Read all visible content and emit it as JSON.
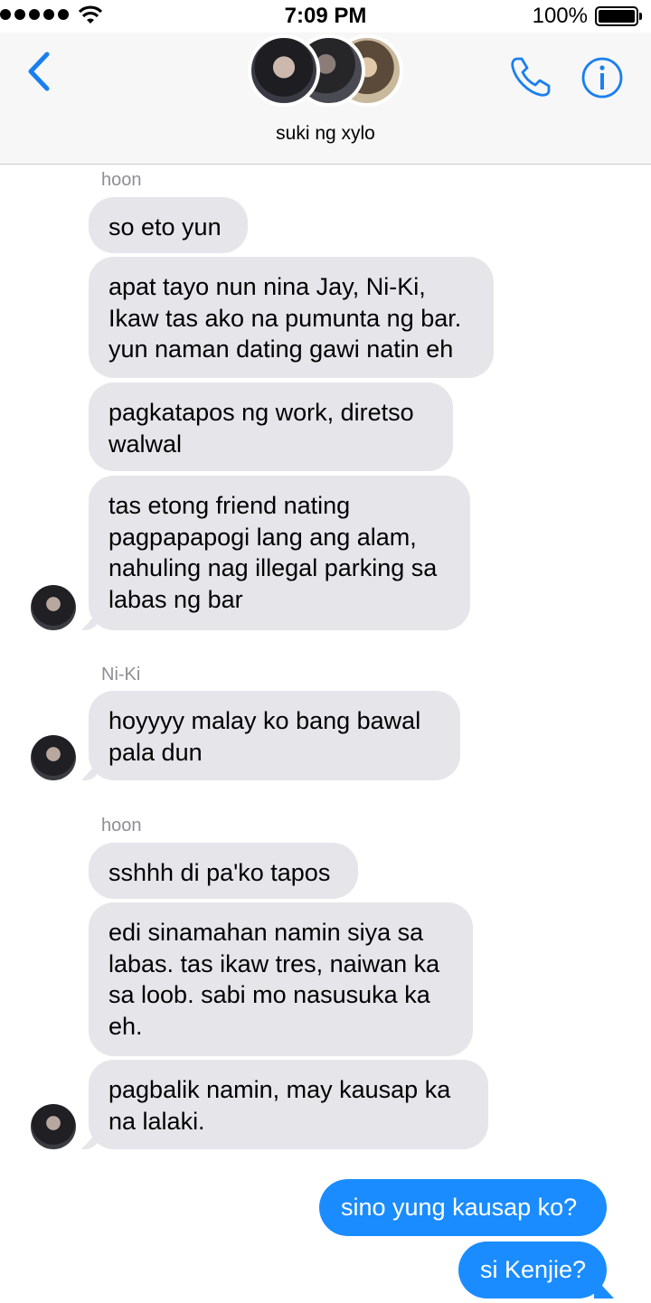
{
  "status_bar": {
    "time": "7:09 PM",
    "battery": "100%"
  },
  "header": {
    "title": "suki ng xylo"
  },
  "messages": [
    {
      "sender": "hoon"
    },
    {
      "text": "so eto yun"
    },
    {
      "text": "apat tayo nun nina Jay, Ni-Ki,\nIkaw tas ako na pumunta ng bar.\nyun naman dating gawi natin eh"
    },
    {
      "text": "pagkatapos ng work, diretso\nwalwal"
    },
    {
      "text": "tas etong friend nating\npagpapapogi lang ang alam,\nnahuling nag illegal parking sa\nlabas ng bar"
    },
    {
      "sender": "Ni-Ki"
    },
    {
      "text": "hoyyyy malay ko bang bawal\npala dun"
    },
    {
      "sender": "hoon"
    },
    {
      "text": "sshhh di pa'ko tapos"
    },
    {
      "text": "edi sinamahan namin siya sa\nlabas. tas ikaw tres, naiwan ka\nsa loob. sabi mo nasusuka ka\neh."
    },
    {
      "text": "pagbalik namin, may kausap ka\nna lalaki."
    },
    {
      "text": "sino yung kausap ko?"
    },
    {
      "text": "si Kenjie?"
    }
  ]
}
